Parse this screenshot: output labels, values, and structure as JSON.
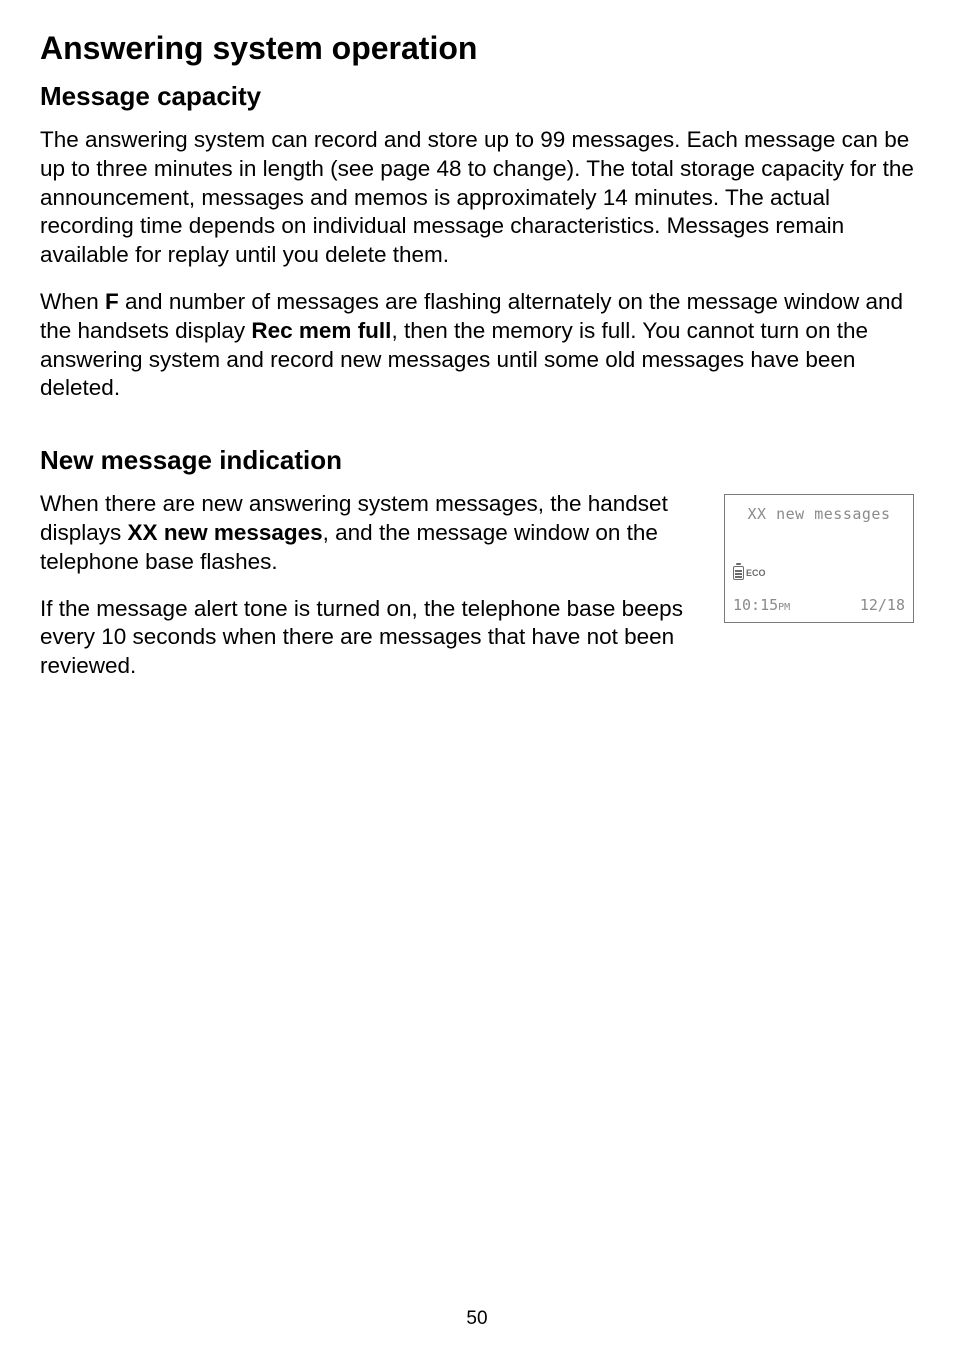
{
  "page_number": "50",
  "title": "Answering system operation",
  "section1": {
    "heading": "Message capacity",
    "p1_before_bold": "The answering system can record and store up to 99 messages. Each message can be up to three minutes in length (see page 48 to change). The total storage capacity for the announcement, messages and memos is approximately 14 minutes. The actual recording time depends on individual message characteristics. Messages remain available for replay until you delete them.",
    "p2_a": "When ",
    "p2_b_bold": "F",
    "p2_c": " and number of messages are flashing alternately on the message window and the handsets display ",
    "p2_d_bold": "Rec mem full",
    "p2_e": ", then the memory is full. You cannot turn on the answering system and record new messages until some old messages have been deleted."
  },
  "section2": {
    "heading": "New message indication",
    "p1_a": "When there are new answering system messages, the handset displays ",
    "p1_b_bold": "XX new messages",
    "p1_c": ", and the message window on the telephone base flashes.",
    "p2": "If the message alert tone is turned on, the telephone base beeps every 10 seconds when there are messages that have not been reviewed."
  },
  "screen": {
    "line1": "XX new messages",
    "eco_label": "ECO",
    "time_main": "10:15",
    "time_suffix": "PM",
    "date": "12/18",
    "icon_name": "battery-icon"
  }
}
